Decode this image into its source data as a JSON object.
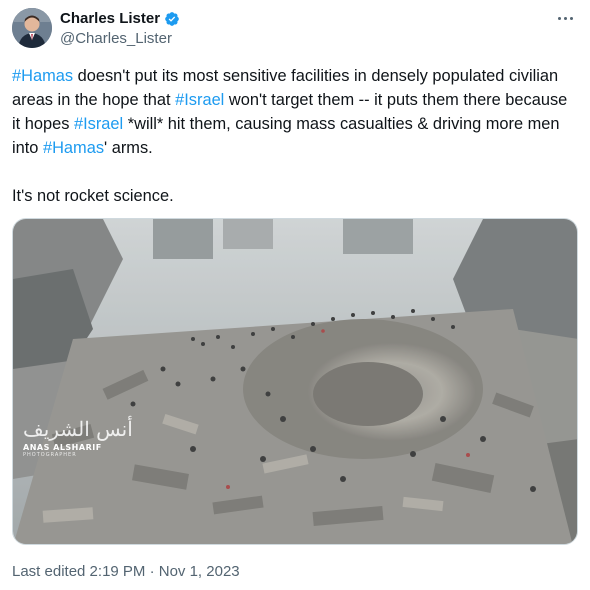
{
  "author": {
    "name": "Charles Lister",
    "handle": "@Charles_Lister",
    "verified": true,
    "verified_color": "#1d9bf0"
  },
  "more_icon": "more-horizontal-icon",
  "tweet": {
    "paragraph1": [
      {
        "type": "hashtag",
        "text": "#Hamas"
      },
      {
        "type": "text",
        "text": " doesn't put its most sensitive facilities in densely populated civilian areas in the hope that "
      },
      {
        "type": "hashtag",
        "text": "#Israel"
      },
      {
        "type": "text",
        "text": " won't target them -- it puts them there because it hopes "
      },
      {
        "type": "hashtag",
        "text": "#Israel"
      },
      {
        "type": "text",
        "text": " *will* hit them, causing mass casualties & driving more men into "
      },
      {
        "type": "hashtag",
        "text": "#Hamas"
      },
      {
        "type": "text",
        "text": "' arms."
      }
    ],
    "paragraph2": "It's not rocket science.",
    "hashtag_color": "#1d9bf0"
  },
  "media": {
    "watermark_script": "أنس الشريف",
    "watermark_name": "ANAS ALSHARIF",
    "watermark_sub": "PHOTOGRAPHER"
  },
  "footer": {
    "edited": "Last edited 2:19 PM · Nov 1, 2023"
  }
}
